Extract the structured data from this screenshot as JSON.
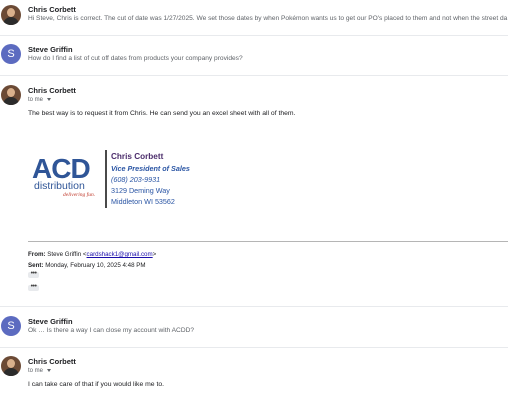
{
  "messages": [
    {
      "sender": "Chris Corbett",
      "snippet": "Hi Steve, Chris is correct. The cut of date was 1/27/2025. We set those dates by when Pokémon wants us to get our PO's placed to them and not when the street da"
    },
    {
      "sender": "Steve Griffin",
      "avatar_letter": "S",
      "snippet": "How do I find a list of cut off dates from products your company provides?"
    },
    {
      "sender": "Chris Corbett",
      "recipient": "to me",
      "body": "The best way is to request it from Chris. He can send you an excel sheet with all of them.",
      "signature": {
        "logo_main": "ACD",
        "logo_sub": "distribution",
        "logo_tagline": "delivering fun.",
        "name": "Chris Corbett",
        "title": "Vice President of Sales",
        "phone": "(608) 203-9931",
        "address1": "3129 Deming Way",
        "address2": "Middleton WI 53562"
      },
      "quoted": {
        "from_label": "From:",
        "from_name": "Steve Griffin <",
        "from_email": "cardshack1@gmail.com",
        "from_close": ">",
        "sent_label": "Sent:",
        "sent_value": "Monday, February 10, 2025 4:48 PM"
      }
    },
    {
      "sender": "Steve Griffin",
      "avatar_letter": "S",
      "snippet": "Ok … Is there a way I can close my account with ACDD?"
    },
    {
      "sender": "Chris Corbett",
      "recipient": "to me",
      "body": "I can take care of that if you would like me to."
    }
  ],
  "colors": {
    "avatar_letter_bg": "#5c6bc0",
    "logo_blue": "#2f5597",
    "logo_red": "#c0392b",
    "sig_purple": "#4b2c6b",
    "sig_blue": "#2a55a4"
  },
  "icons": {
    "expand": "ellipsis-icon",
    "recipient_menu": "caret-down-icon"
  }
}
